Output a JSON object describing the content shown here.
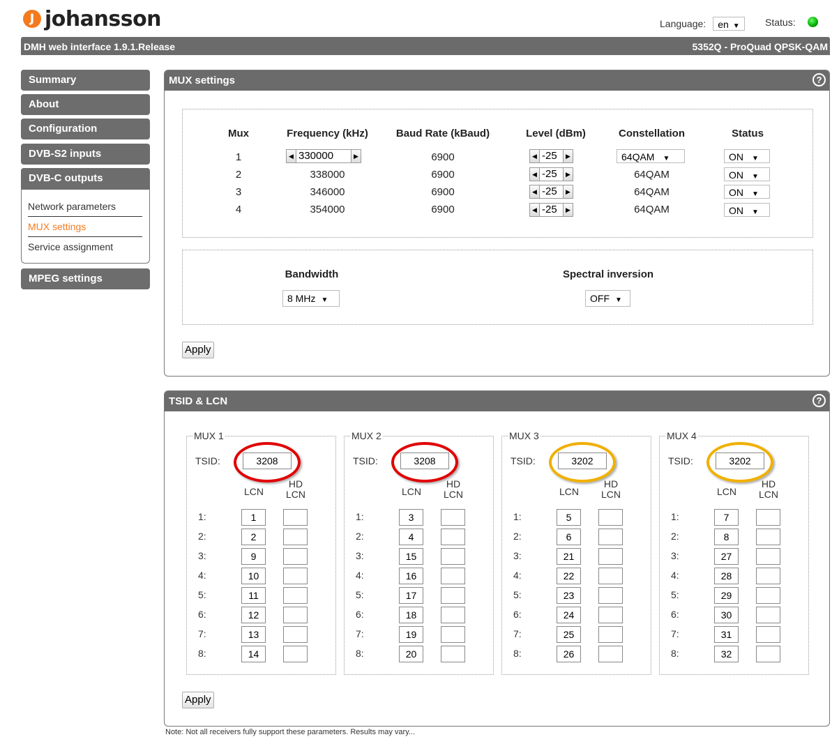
{
  "brand": {
    "logo_letter": "J",
    "name": "johansson"
  },
  "header": {
    "language_label": "Language:",
    "language_value": "en",
    "status_label": "Status:",
    "status_color": "#00aa00"
  },
  "topbar": {
    "left": "DMH web interface 1.9.1.Release",
    "right": "5352Q - ProQuad QPSK-QAM"
  },
  "sidebar": {
    "items": [
      "Summary",
      "About",
      "Configuration",
      "DVB-S2 inputs",
      "DVB-C outputs",
      "MPEG settings"
    ],
    "subitems": [
      "Network parameters",
      "MUX settings",
      "Service assignment"
    ],
    "active_sub": "MUX settings"
  },
  "mux_panel": {
    "title": "MUX settings",
    "help": "?",
    "headers": [
      "Mux",
      "Frequency (kHz)",
      "Baud Rate (kBaud)",
      "Level (dBm)",
      "Constellation",
      "Status"
    ],
    "rows": [
      {
        "mux": "1",
        "frequency": "330000",
        "baud": "6900",
        "level": "-25",
        "constellation": "64QAM",
        "status": "ON"
      },
      {
        "mux": "2",
        "frequency": "338000",
        "baud": "6900",
        "level": "-25",
        "constellation": "64QAM",
        "status": "ON"
      },
      {
        "mux": "3",
        "frequency": "346000",
        "baud": "6900",
        "level": "-25",
        "constellation": "64QAM",
        "status": "ON"
      },
      {
        "mux": "4",
        "frequency": "354000",
        "baud": "6900",
        "level": "-25",
        "constellation": "64QAM",
        "status": "ON"
      }
    ],
    "bandwidth_label": "Bandwidth",
    "bandwidth_value": "8 MHz",
    "spectral_label": "Spectral inversion",
    "spectral_value": "OFF",
    "apply": "Apply"
  },
  "tsid_panel": {
    "title": "TSID & LCN",
    "help": "?",
    "tsid_label": "TSID:",
    "lcn_header": "LCN",
    "hd_header_1": "HD",
    "hd_header_2": "LCN",
    "row_labels": [
      "1:",
      "2:",
      "3:",
      "4:",
      "5:",
      "6:",
      "7:",
      "8:"
    ],
    "muxes": [
      {
        "name": "MUX 1",
        "tsid": "3208",
        "highlight": "#e00000",
        "lcn": [
          "1",
          "2",
          "9",
          "10",
          "11",
          "12",
          "13",
          "14"
        ]
      },
      {
        "name": "MUX 2",
        "tsid": "3208",
        "highlight": "#e00000",
        "lcn": [
          "3",
          "4",
          "15",
          "16",
          "17",
          "18",
          "19",
          "20"
        ]
      },
      {
        "name": "MUX 3",
        "tsid": "3202",
        "highlight": "#f0b000",
        "lcn": [
          "5",
          "6",
          "21",
          "22",
          "23",
          "24",
          "25",
          "26"
        ]
      },
      {
        "name": "MUX 4",
        "tsid": "3202",
        "highlight": "#f0b000",
        "lcn": [
          "7",
          "8",
          "27",
          "28",
          "29",
          "30",
          "31",
          "32"
        ]
      }
    ],
    "apply": "Apply"
  },
  "note": "Note: Not all receivers fully support these parameters. Results may vary..."
}
